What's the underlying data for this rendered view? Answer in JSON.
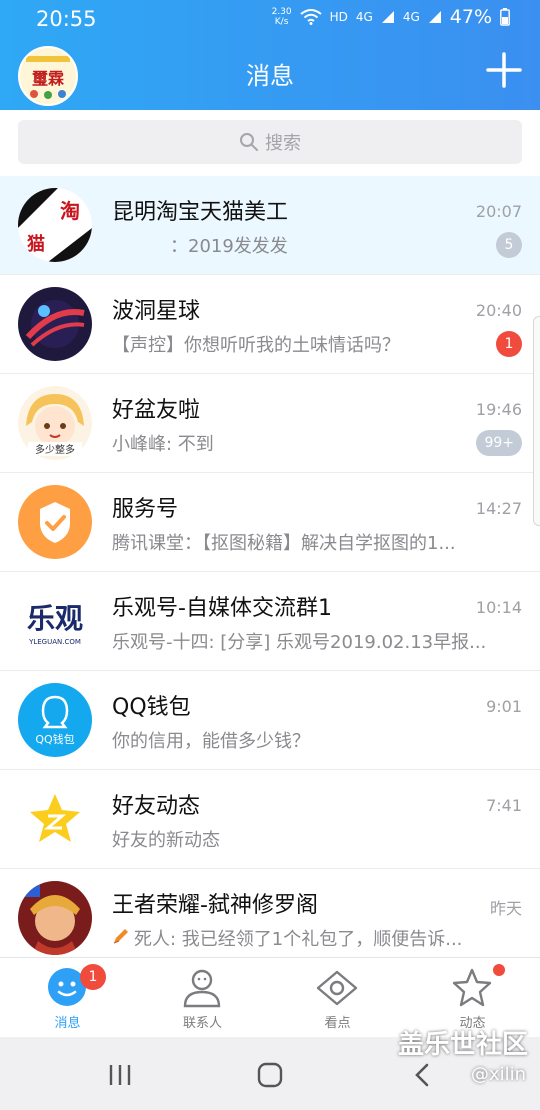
{
  "status_bar": {
    "time": "20:55",
    "net_speed": "2.30\nK/s",
    "hd": "HD",
    "net1": "4G",
    "net2": "4G",
    "battery": "47%"
  },
  "header": {
    "title": "消息",
    "avatar_text": "璽霖"
  },
  "search": {
    "placeholder": "搜索"
  },
  "conversations": [
    {
      "name": "昆明淘宝天猫美工",
      "message": "：2019发发发",
      "time": "20:07",
      "badge": "5",
      "badge_style": "gray",
      "pinned": true,
      "avatar_text": "淘"
    },
    {
      "name": "波洞星球",
      "message": "【声控】你想听听我的土味情话吗？",
      "time": "20:40",
      "badge": "1",
      "badge_style": "red"
    },
    {
      "name": "好盆友啦",
      "message": "小峰峰: 不到",
      "time": "19:46",
      "badge": "99+",
      "badge_style": "gray",
      "avatar_text": "多少整多"
    },
    {
      "name": "服务号",
      "message": "腾讯课堂：【抠图秘籍】解决自学抠图的1...",
      "time": "14:27",
      "badge": ""
    },
    {
      "name": "乐观号-自媒体交流群1",
      "message": "乐观号-十四: [分享] 乐观号2019.02.13早报...",
      "time": "10:14",
      "badge": "",
      "avatar_text": "乐观",
      "avatar_sub": "YLEGUAN.COM"
    },
    {
      "name": "QQ钱包",
      "message": "你的信用，能借多少钱？",
      "time": "9:01",
      "badge": "",
      "avatar_text": "QQ钱包"
    },
    {
      "name": "好友动态",
      "message": "好友的新动态",
      "time": "7:41",
      "badge": ""
    },
    {
      "name": "王者荣耀-弑神修罗阁",
      "message": "死人: 我已经领了1个礼包了，顺便告诉...",
      "time": "昨天",
      "badge": ""
    }
  ],
  "tabs": [
    {
      "label": "消息",
      "badge": "1"
    },
    {
      "label": "联系人"
    },
    {
      "label": "看点"
    },
    {
      "label": "动态"
    }
  ],
  "watermark": {
    "line1": "盖乐世社区",
    "line2": "@xilin"
  },
  "colors": {
    "accent": "#2ea0f5",
    "badge_red": "#f04b3c",
    "badge_gray": "#c3ccd6",
    "pinned_bg": "#ecf8ff"
  }
}
